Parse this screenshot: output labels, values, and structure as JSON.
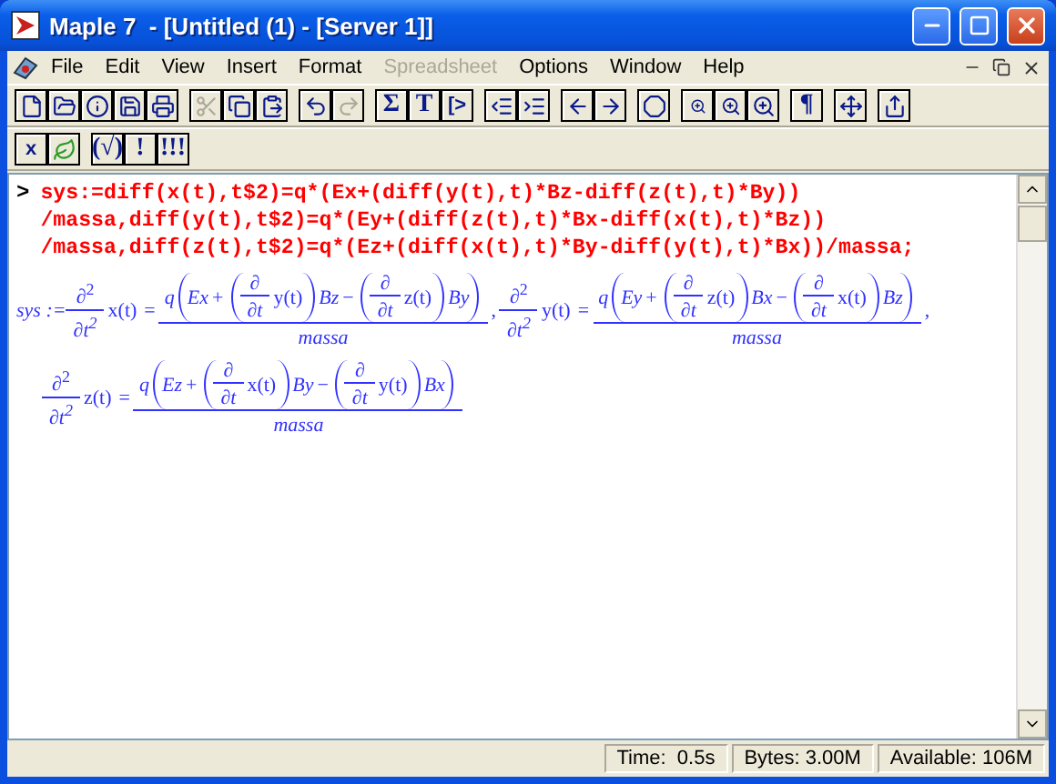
{
  "window": {
    "title": "Maple 7  - [Untitled (1) - [Server 1]]"
  },
  "menu": [
    {
      "label": "File",
      "disabled": false
    },
    {
      "label": "Edit",
      "disabled": false
    },
    {
      "label": "View",
      "disabled": false
    },
    {
      "label": "Insert",
      "disabled": false
    },
    {
      "label": "Format",
      "disabled": false
    },
    {
      "label": "Spreadsheet",
      "disabled": true
    },
    {
      "label": "Options",
      "disabled": false
    },
    {
      "label": "Window",
      "disabled": false
    },
    {
      "label": "Help",
      "disabled": false
    }
  ],
  "toolbar": [
    [
      {
        "kind": "new",
        "disabled": false
      },
      {
        "kind": "open",
        "disabled": false
      },
      {
        "kind": "info",
        "disabled": false
      },
      {
        "kind": "save",
        "disabled": false
      },
      {
        "kind": "print",
        "disabled": false
      }
    ],
    [
      {
        "kind": "cut",
        "disabled": true
      },
      {
        "kind": "copy",
        "disabled": false
      },
      {
        "kind": "paste",
        "disabled": false
      }
    ],
    [
      {
        "kind": "undo",
        "disabled": false
      },
      {
        "kind": "redo",
        "disabled": true
      }
    ],
    [
      {
        "kind": "glyph",
        "label": "Σ",
        "disabled": false
      },
      {
        "kind": "glyph",
        "label": "T",
        "disabled": false
      },
      {
        "kind": "text",
        "label": "[>",
        "disabled": false
      }
    ],
    [
      {
        "kind": "outdent",
        "disabled": false
      },
      {
        "kind": "indent",
        "disabled": false
      }
    ],
    [
      {
        "kind": "back",
        "disabled": false
      },
      {
        "kind": "forward",
        "disabled": false
      }
    ],
    [
      {
        "kind": "stop",
        "disabled": false
      }
    ],
    [
      {
        "kind": "zoom1",
        "disabled": false
      },
      {
        "kind": "zoom2",
        "disabled": false
      },
      {
        "kind": "zoom3",
        "disabled": false
      }
    ],
    [
      {
        "kind": "glyph",
        "label": "¶",
        "disabled": false
      }
    ],
    [
      {
        "kind": "move",
        "disabled": false
      }
    ],
    [
      {
        "kind": "export",
        "disabled": false
      }
    ]
  ],
  "toolbar2": [
    [
      {
        "kind": "text",
        "label": "x",
        "disabled": false
      },
      {
        "kind": "leaf",
        "disabled": false
      }
    ],
    [
      {
        "kind": "glyph",
        "label": "(√)",
        "disabled": false
      },
      {
        "kind": "glyph",
        "label": "!",
        "disabled": false
      },
      {
        "kind": "glyph",
        "label": "!!!",
        "disabled": false
      }
    ]
  ],
  "worksheet": {
    "prompt": ">",
    "input": [
      "sys:=diff(x(t),t$2)=q*(Ex+(diff(y(t),t)*Bz-diff(z(t),t)*By))",
      "/massa,diff(y(t),t$2)=q*(Ey+(diff(z(t),t)*Bx-diff(x(t),t)*Bz))",
      "/massa,diff(z(t),t$2)=q*(Ez+(diff(x(t),t)*By-diff(y(t),t)*Bx))/massa;"
    ],
    "output": {
      "label": "sys :=",
      "equations": [
        {
          "d2": {
            "top": "∂",
            "top_exp": "2",
            "bottom": "∂t",
            "bottom_exp": "2"
          },
          "func": "x(t)",
          "eq": "=",
          "num": {
            "coef": "q",
            "first": "Ex",
            "plus": "+",
            "term1": {
              "top": "∂",
              "bottom": "∂t",
              "func": "y(t)"
            },
            "mul1": "Bz",
            "minus": "−",
            "term2": {
              "top": "∂",
              "bottom": "∂t",
              "func": "z(t)"
            },
            "mul2": "By"
          },
          "den": "massa",
          "sep": ","
        },
        {
          "d2": {
            "top": "∂",
            "top_exp": "2",
            "bottom": "∂t",
            "bottom_exp": "2"
          },
          "func": "y(t)",
          "eq": "=",
          "num": {
            "coef": "q",
            "first": "Ey",
            "plus": "+",
            "term1": {
              "top": "∂",
              "bottom": "∂t",
              "func": "z(t)"
            },
            "mul1": "Bx",
            "minus": "−",
            "term2": {
              "top": "∂",
              "bottom": "∂t",
              "func": "x(t)"
            },
            "mul2": "Bz"
          },
          "den": "massa",
          "sep": ","
        },
        {
          "d2": {
            "top": "∂",
            "top_exp": "2",
            "bottom": "∂t",
            "bottom_exp": "2"
          },
          "func": "z(t)",
          "eq": "=",
          "num": {
            "coef": "q",
            "first": "Ez",
            "plus": "+",
            "term1": {
              "top": "∂",
              "bottom": "∂t",
              "func": "x(t)"
            },
            "mul1": "By",
            "minus": "−",
            "term2": {
              "top": "∂",
              "bottom": "∂t",
              "func": "y(t)"
            },
            "mul2": "Bx"
          },
          "den": "massa"
        }
      ]
    }
  },
  "status_bar": [
    "Time:  0.5s",
    "Bytes: 3.00M",
    "Available: 106M"
  ]
}
